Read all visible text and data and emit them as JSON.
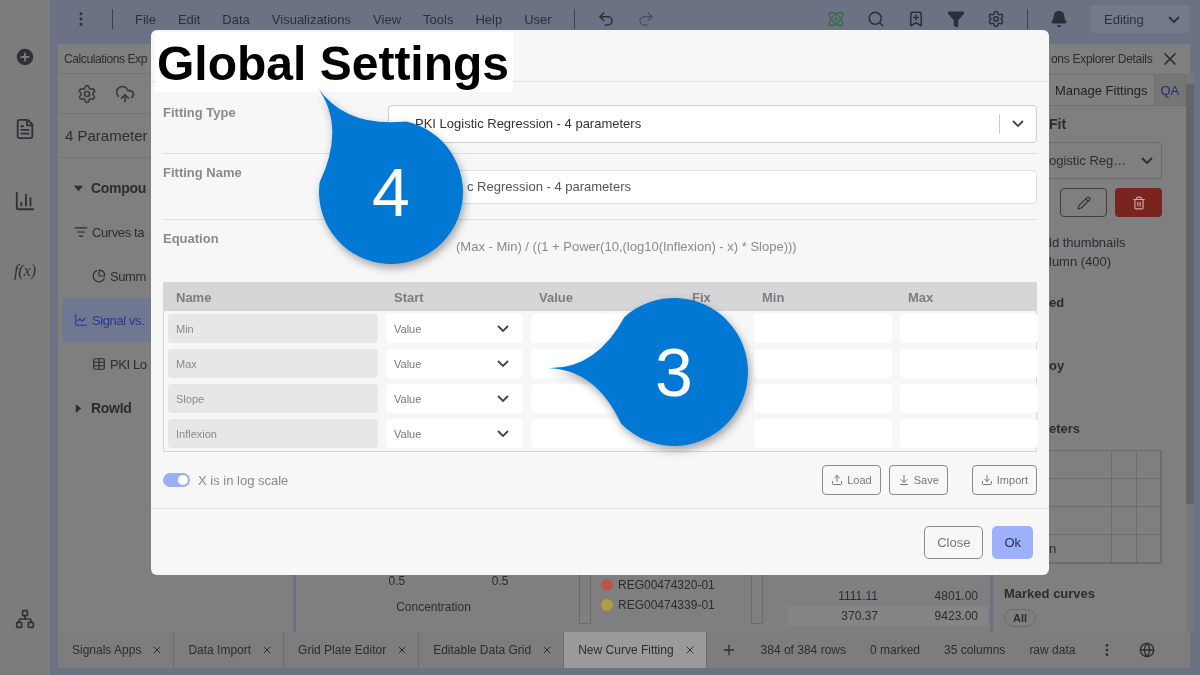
{
  "menu": {
    "items": [
      "File",
      "Edit",
      "Data",
      "Visualizations",
      "View",
      "Tools",
      "Help",
      "User"
    ],
    "mode": "Editing"
  },
  "rail": {
    "formula": "f(x)"
  },
  "left_panel": {
    "title": "Calculations Exp",
    "subtitle": "4 Parameter",
    "tree": [
      {
        "label": "Compou",
        "kind": "group",
        "expanded": true,
        "selected": false,
        "children": [
          {
            "label": "Curves ta",
            "kind": "sort",
            "selected": false,
            "children": [
              {
                "label": "Summ",
                "kind": "pie",
                "selected": false
              }
            ]
          },
          {
            "label": "Signal vs.",
            "kind": "line",
            "selected": true,
            "children": [
              {
                "label": "PKI Lo",
                "kind": "grid",
                "selected": false
              }
            ]
          }
        ]
      },
      {
        "label": "RowId",
        "kind": "group",
        "expanded": false,
        "selected": false
      }
    ]
  },
  "dialog": {
    "fields": [
      {
        "label": "Fitting Type",
        "kind": "select",
        "value": "PKI Logistic Regression - 4 parameters"
      },
      {
        "label": "Fitting Name",
        "kind": "input",
        "value": "c Regression - 4 parameters"
      },
      {
        "label": "Equation",
        "kind": "text",
        "value": "(Max - Min) / ((1 + Power(10,(log10(Inflexion) - x) * Slope)))"
      }
    ],
    "parameters": {
      "columns": [
        "Name",
        "Start",
        "Value",
        "Fix",
        "Min",
        "Max"
      ],
      "rows": [
        {
          "name": "Min",
          "start": "Value"
        },
        {
          "name": "Max",
          "start": "Value"
        },
        {
          "name": "Slope",
          "start": "Value"
        },
        {
          "name": "Inflexion",
          "start": "Value"
        }
      ]
    },
    "log_scale": {
      "label": "X is in log scale",
      "on": true
    },
    "actions": [
      {
        "label": "Load",
        "kind": "upload"
      },
      {
        "label": "Save",
        "kind": "save"
      },
      {
        "label": "Import",
        "kind": "download"
      }
    ],
    "footer": [
      {
        "label": "Close",
        "primary": false
      },
      {
        "label": "Ok",
        "primary": true
      }
    ]
  },
  "annotations": {
    "title": "Global Settings",
    "callouts": [
      "4",
      "3"
    ]
  },
  "center": {
    "x_ticks": [
      "0.5",
      "0.5"
    ],
    "xlabel": "Concentration",
    "legend": [
      {
        "label": "REG00474320-01",
        "color": "#b5574f"
      },
      {
        "label": "REG00474339-01",
        "color": "#b39c47"
      }
    ],
    "rows": [
      [
        "1111.11",
        "4801.00"
      ],
      [
        "370.37",
        "9423.00"
      ]
    ]
  },
  "right_panel": {
    "title": "ons Explorer Details",
    "tabs": [
      {
        "label": "Manage Fittings",
        "selected": true
      },
      {
        "label": "QA",
        "selected": false
      }
    ],
    "section": "Fit",
    "fit_select": "ogistic Reg…",
    "notes": [
      "ld thumbnails",
      "lumn (400)"
    ],
    "headings": [
      "ed",
      "oy",
      "eters"
    ],
    "grid_rows": [
      "",
      "",
      "",
      "n"
    ],
    "marked": "Marked curves",
    "filter": "All"
  },
  "status": {
    "tabs": [
      {
        "label": "Signals Apps",
        "selected": false
      },
      {
        "label": "Data Import",
        "selected": false
      },
      {
        "label": "Grid Plate Editor",
        "selected": false
      },
      {
        "label": "Editable Data Grid",
        "selected": false
      },
      {
        "label": "New Curve Fitting",
        "selected": true
      }
    ],
    "stats": [
      "384 of 384 rows",
      "0 marked",
      "35 columns",
      "raw data"
    ]
  }
}
